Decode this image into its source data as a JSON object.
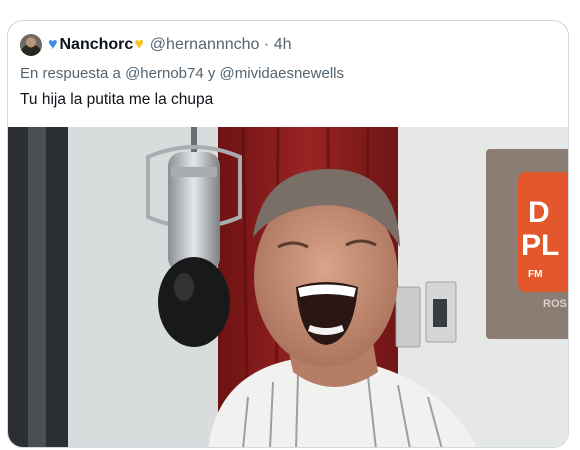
{
  "tweet": {
    "display_name": "Nanchorc",
    "name_emoji_left": "heart-blue-icon",
    "name_emoji_right": "heart-yellow-icon",
    "handle": "@hernannncho",
    "separator": "·",
    "time": "4h",
    "reply_prefix": "En respuesta a",
    "reply_user_1": "@hernob74",
    "reply_joiner": "y",
    "reply_user_2": "@mividaesnewells",
    "text": "Tu hija la putita me la chupa"
  },
  "media": {
    "description_icon": "radio-studio-photo",
    "sign_text_1": "D",
    "sign_text_2": "PL",
    "sign_small": "FM",
    "sign_city": "ROS"
  },
  "colors": {
    "secondary_text": "#536471",
    "border": "#cfd9de",
    "primary_text": "#0f1419",
    "curtain": "#8a1c1c",
    "sign_orange": "#e2572c"
  }
}
